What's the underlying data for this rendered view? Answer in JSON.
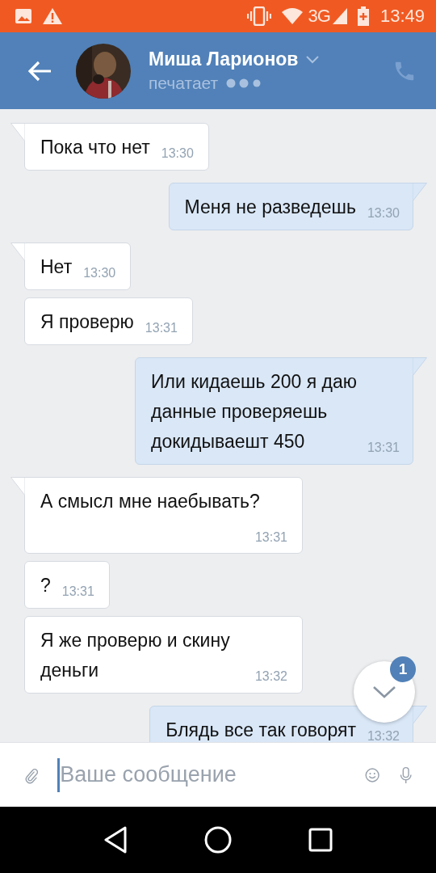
{
  "status_bar": {
    "network": "3G",
    "time": "13:49"
  },
  "header": {
    "name": "Миша Ларионов",
    "status": "печатает"
  },
  "messages": [
    {
      "outgoing": false,
      "tail": true,
      "text": "Пока что нет",
      "time": "13:30"
    },
    {
      "outgoing": true,
      "tail": true,
      "text": "Меня не разведешь",
      "time": "13:30"
    },
    {
      "outgoing": false,
      "tail": true,
      "text": "Нет",
      "time": "13:30"
    },
    {
      "outgoing": false,
      "tail": false,
      "text": "Я проверю",
      "time": "13:31"
    },
    {
      "outgoing": true,
      "tail": true,
      "text": "Или кидаешь 200 я даю данные проверяешь докидываешт 450",
      "time": "13:31"
    },
    {
      "outgoing": false,
      "tail": true,
      "text": "А смысл мне наебывать?",
      "time": "13:31"
    },
    {
      "outgoing": false,
      "tail": false,
      "text": "?",
      "time": "13:31"
    },
    {
      "outgoing": false,
      "tail": false,
      "text": "Я же проверю и скину деньги",
      "time": "13:32"
    },
    {
      "outgoing": true,
      "tail": true,
      "text": "Блядь все так говорят",
      "time": "13:32"
    }
  ],
  "scroll_button": {
    "badge": "1"
  },
  "composer": {
    "placeholder": "Ваше сообщение"
  }
}
